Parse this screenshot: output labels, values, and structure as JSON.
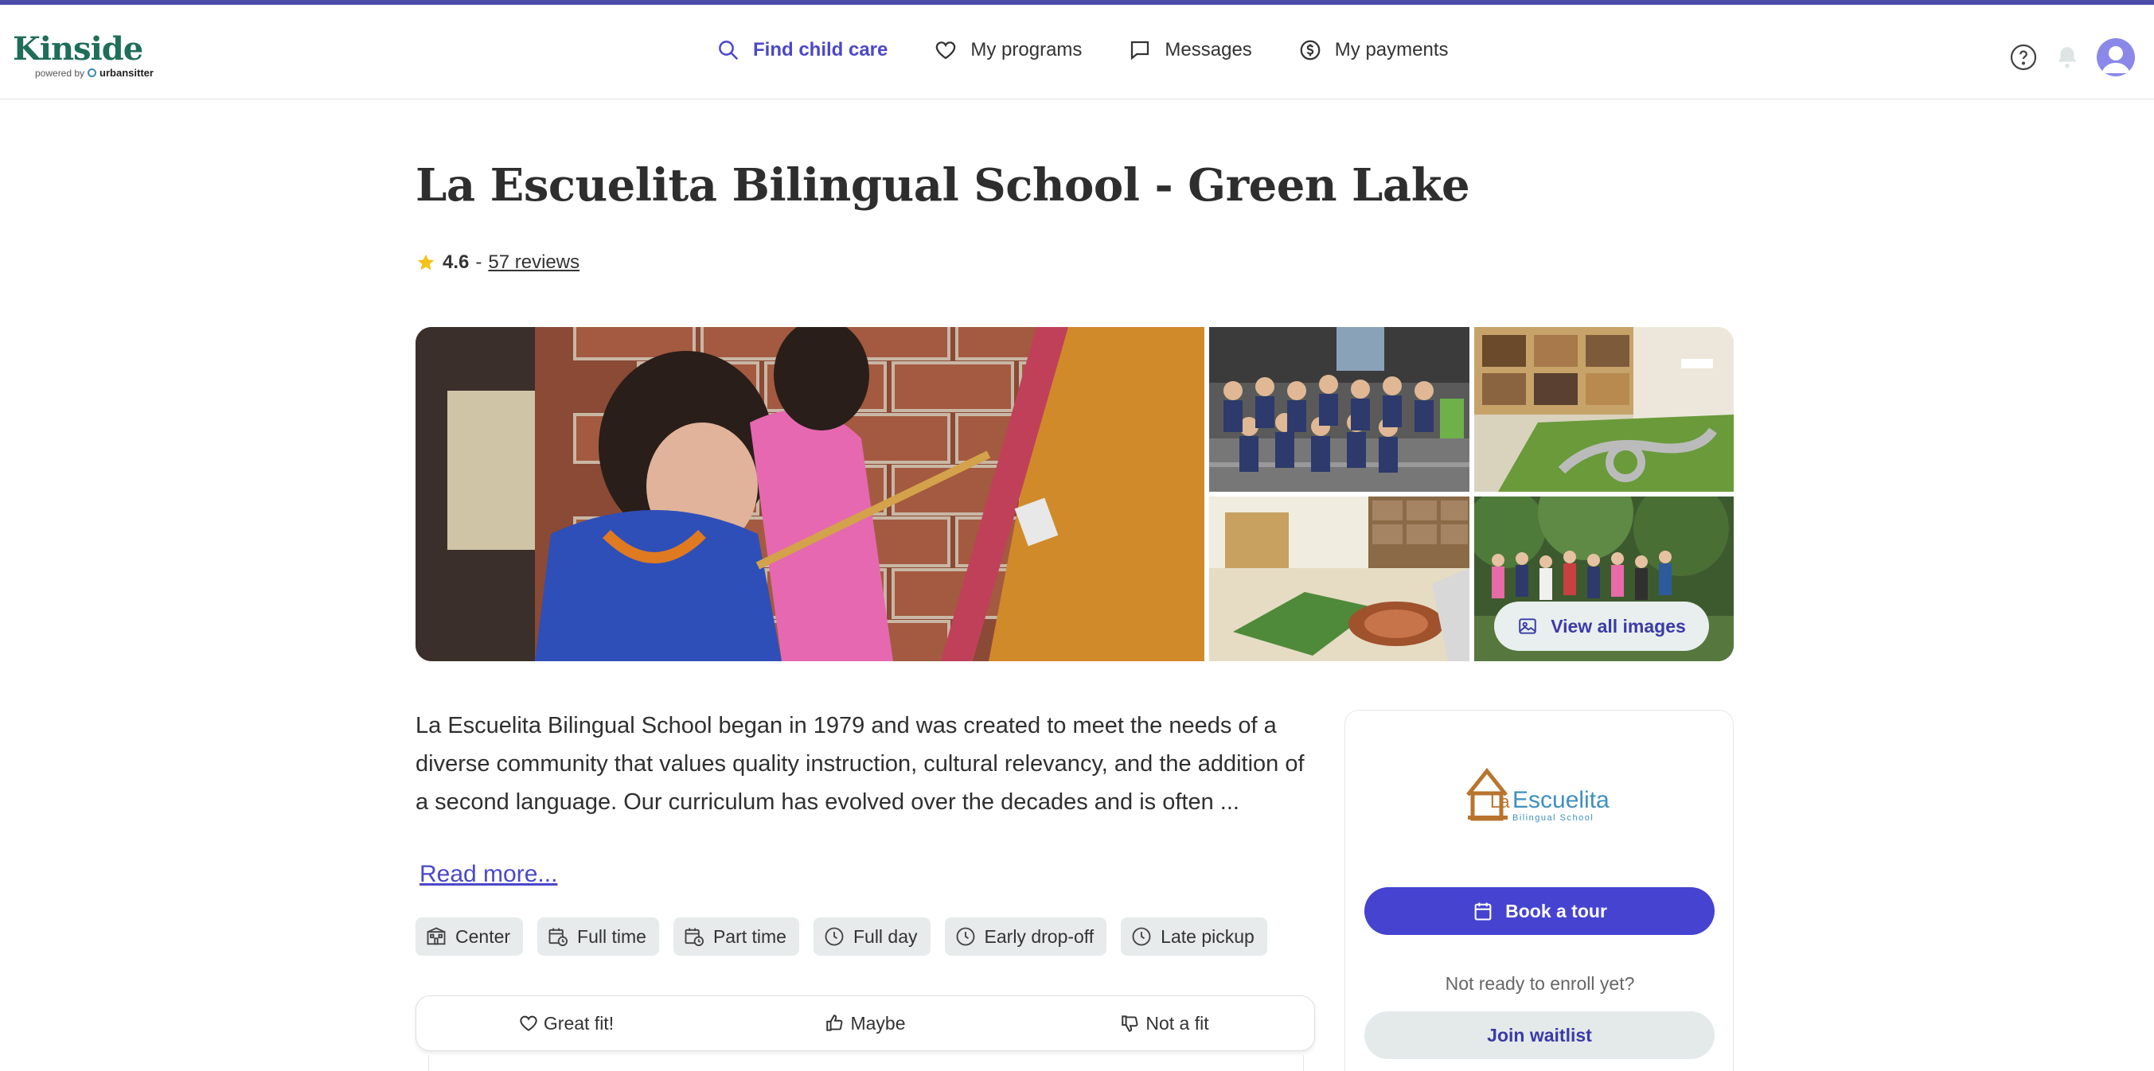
{
  "brand": {
    "name": "Kinside",
    "powered_by": "powered by",
    "partner": "urbansitter",
    "color": "#1f6e5a"
  },
  "nav": {
    "items": [
      {
        "label": "Find child care",
        "icon": "search-icon",
        "active": true
      },
      {
        "label": "My programs",
        "icon": "heart-icon",
        "active": false
      },
      {
        "label": "Messages",
        "icon": "message-icon",
        "active": false
      },
      {
        "label": "My payments",
        "icon": "dollar-icon",
        "active": false
      }
    ],
    "accent": "#4b48c8"
  },
  "header_icons": [
    "help-icon",
    "bell-icon",
    "avatar"
  ],
  "school": {
    "name": "La Escuelita Bilingual School - Green Lake",
    "rating": "4.6",
    "separator": "-",
    "reviews": "57 reviews",
    "description": "La Escuelita Bilingual School began in 1979 and was created to meet the needs of a diverse community that values quality instruction, cultural relevancy, and the addition of a second language. Our curriculum has evolved over the decades and is often ...",
    "read_more": "Read more..."
  },
  "gallery": {
    "view_all": "View all images"
  },
  "tags": [
    {
      "label": "Center",
      "icon": "building-icon"
    },
    {
      "label": "Full time",
      "icon": "calendar-clock-icon"
    },
    {
      "label": "Part time",
      "icon": "calendar-clock-icon"
    },
    {
      "label": "Full day",
      "icon": "clock-icon"
    },
    {
      "label": "Early drop-off",
      "icon": "clock-icon"
    },
    {
      "label": "Late pickup",
      "icon": "clock-icon"
    }
  ],
  "feedback": {
    "great": "Great fit!",
    "maybe": "Maybe",
    "not": "Not a fit"
  },
  "sidebar": {
    "logo_main_a": "La",
    "logo_main_b": "Escuelita",
    "logo_sub": "Bilingual School",
    "book_tour": "Book a tour",
    "not_ready": "Not ready to enroll yet?",
    "join_waitlist": "Join waitlist",
    "primary_color": "#4543d0"
  }
}
